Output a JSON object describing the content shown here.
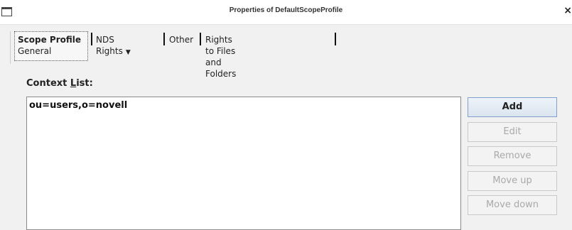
{
  "window": {
    "title": "Properties of DefaultScopeProfile",
    "close_glyph": "×"
  },
  "tabs": [
    {
      "label": "Scope Profile",
      "sublabel": "General",
      "active": true
    },
    {
      "label": "NDS Rights",
      "has_dropdown": true,
      "active": false
    },
    {
      "label": "Other",
      "active": false
    },
    {
      "label": "Rights to Files and Folders",
      "active": false
    }
  ],
  "context": {
    "label_prefix": "Context ",
    "label_underlined": "L",
    "label_suffix": "ist:",
    "items": [
      "ou=users,o=novell"
    ]
  },
  "buttons": {
    "add": "Add",
    "edit": "Edit",
    "remove": "Remove",
    "move_up": "Move up",
    "move_down": "Move down"
  },
  "icons": {
    "window_menu": "window-menu-icon",
    "close": "close-icon",
    "dropdown": "chevron-down-icon"
  }
}
